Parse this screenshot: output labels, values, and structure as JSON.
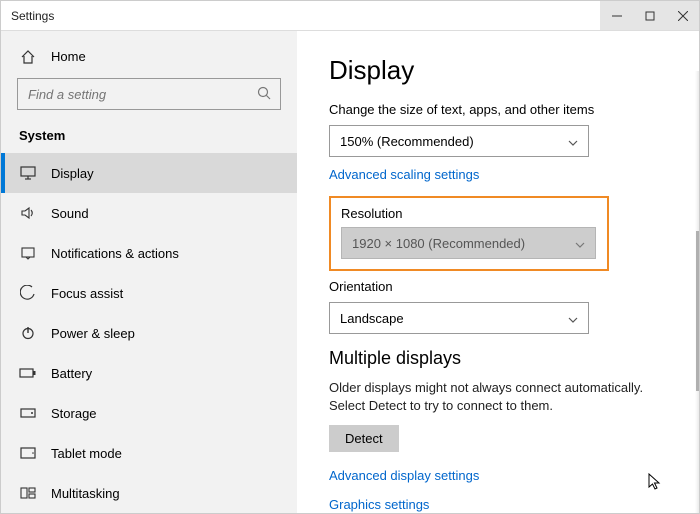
{
  "titlebar": {
    "title": "Settings"
  },
  "sidebar": {
    "home": "Home",
    "search_placeholder": "Find a setting",
    "section": "System",
    "items": [
      {
        "label": "Display"
      },
      {
        "label": "Sound"
      },
      {
        "label": "Notifications & actions"
      },
      {
        "label": "Focus assist"
      },
      {
        "label": "Power & sleep"
      },
      {
        "label": "Battery"
      },
      {
        "label": "Storage"
      },
      {
        "label": "Tablet mode"
      },
      {
        "label": "Multitasking"
      }
    ]
  },
  "main": {
    "title": "Display",
    "scale_label": "Change the size of text, apps, and other items",
    "scale_value": "150% (Recommended)",
    "adv_scaling": "Advanced scaling settings",
    "resolution_label": "Resolution",
    "resolution_value": "1920 × 1080 (Recommended)",
    "orientation_label": "Orientation",
    "orientation_value": "Landscape",
    "multi_heading": "Multiple displays",
    "multi_desc": "Older displays might not always connect automatically. Select Detect to try to connect to them.",
    "detect_btn": "Detect",
    "adv_display": "Advanced display settings",
    "graphics": "Graphics settings"
  }
}
